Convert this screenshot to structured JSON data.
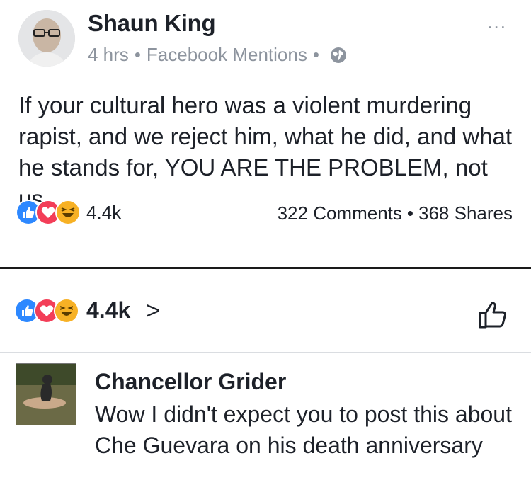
{
  "post": {
    "author": "Shaun King",
    "time": "4 hrs",
    "source": "Facebook Mentions",
    "separator": "•",
    "privacy_icon": "globe-icon",
    "more_label": "...",
    "text": "If your cultural hero was a violent murdering rapist, and we reject him, what he did, and what he stands for, YOU ARE THE PROBLEM, not us.",
    "reactions": [
      "like-icon",
      "love-icon",
      "haha-icon"
    ],
    "reaction_count": "4.4k",
    "comments": "322 Comments",
    "shares": "368 Shares"
  },
  "comments_view": {
    "reaction_count": "4.4k",
    "chevron": ">",
    "like_icon": "thumbs-up-outline-icon"
  },
  "comment": {
    "author": "Chancellor Grider",
    "text": "Wow I didn't expect you to post this about Che Guevara on his death anniversary"
  },
  "colors": {
    "like_blue": "#2d88ff",
    "love_red": "#f33e58",
    "haha_yellow": "#f7b125",
    "secondary_text": "#8d949e"
  }
}
